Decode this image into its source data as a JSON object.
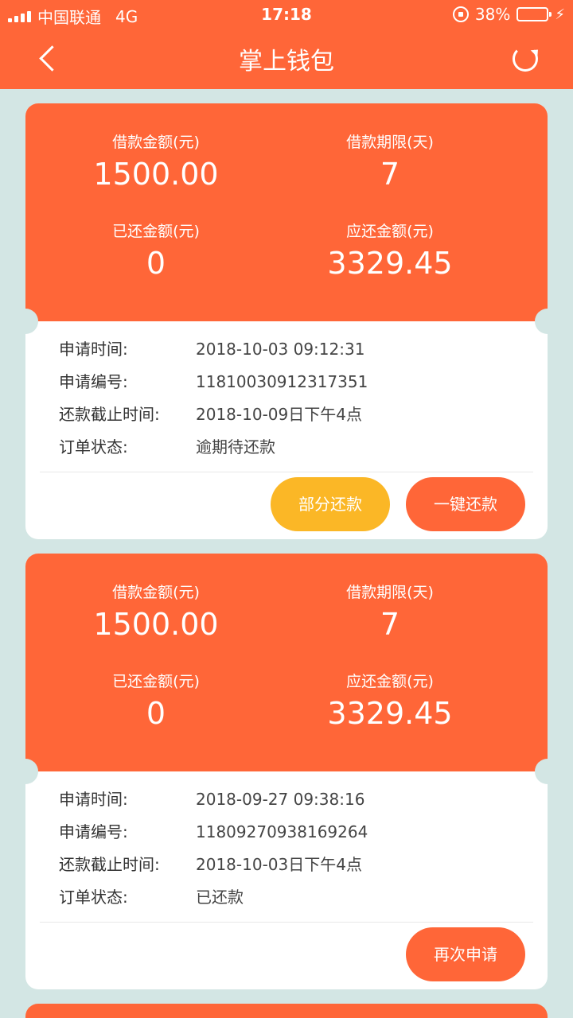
{
  "status": {
    "carrier": "中国联通",
    "network": "4G",
    "time": "17:18",
    "battery": "38%",
    "battery_fill": 0.38
  },
  "nav": {
    "title": "掌上钱包"
  },
  "labels": {
    "loan_amount": "借款金额(元)",
    "loan_term": "借款期限(天)",
    "repaid_amount": "已还金额(元)",
    "due_amount": "应还金额(元)",
    "apply_time": "申请时间:",
    "apply_no": "申请编号:",
    "deadline": "还款截止时间:",
    "order_status": "订单状态:"
  },
  "orders": [
    {
      "loan_amount": "1500.00",
      "loan_term": "7",
      "repaid_amount": "0",
      "due_amount": "3329.45",
      "apply_time": "2018-10-03 09:12:31",
      "apply_no": "11810030912317351",
      "deadline": "2018-10-09日下午4点",
      "status": "逾期待还款",
      "buttons": [
        "部分还款",
        "一键还款"
      ]
    },
    {
      "loan_amount": "1500.00",
      "loan_term": "7",
      "repaid_amount": "0",
      "due_amount": "3329.45",
      "apply_time": "2018-09-27 09:38:16",
      "apply_no": "11809270938169264",
      "deadline": "2018-10-03日下午4点",
      "status": "已还款",
      "buttons": [
        "再次申请"
      ]
    }
  ],
  "colors": {
    "primary": "#ff6638",
    "secondary": "#fbb726",
    "background": "#d3e6e4"
  }
}
